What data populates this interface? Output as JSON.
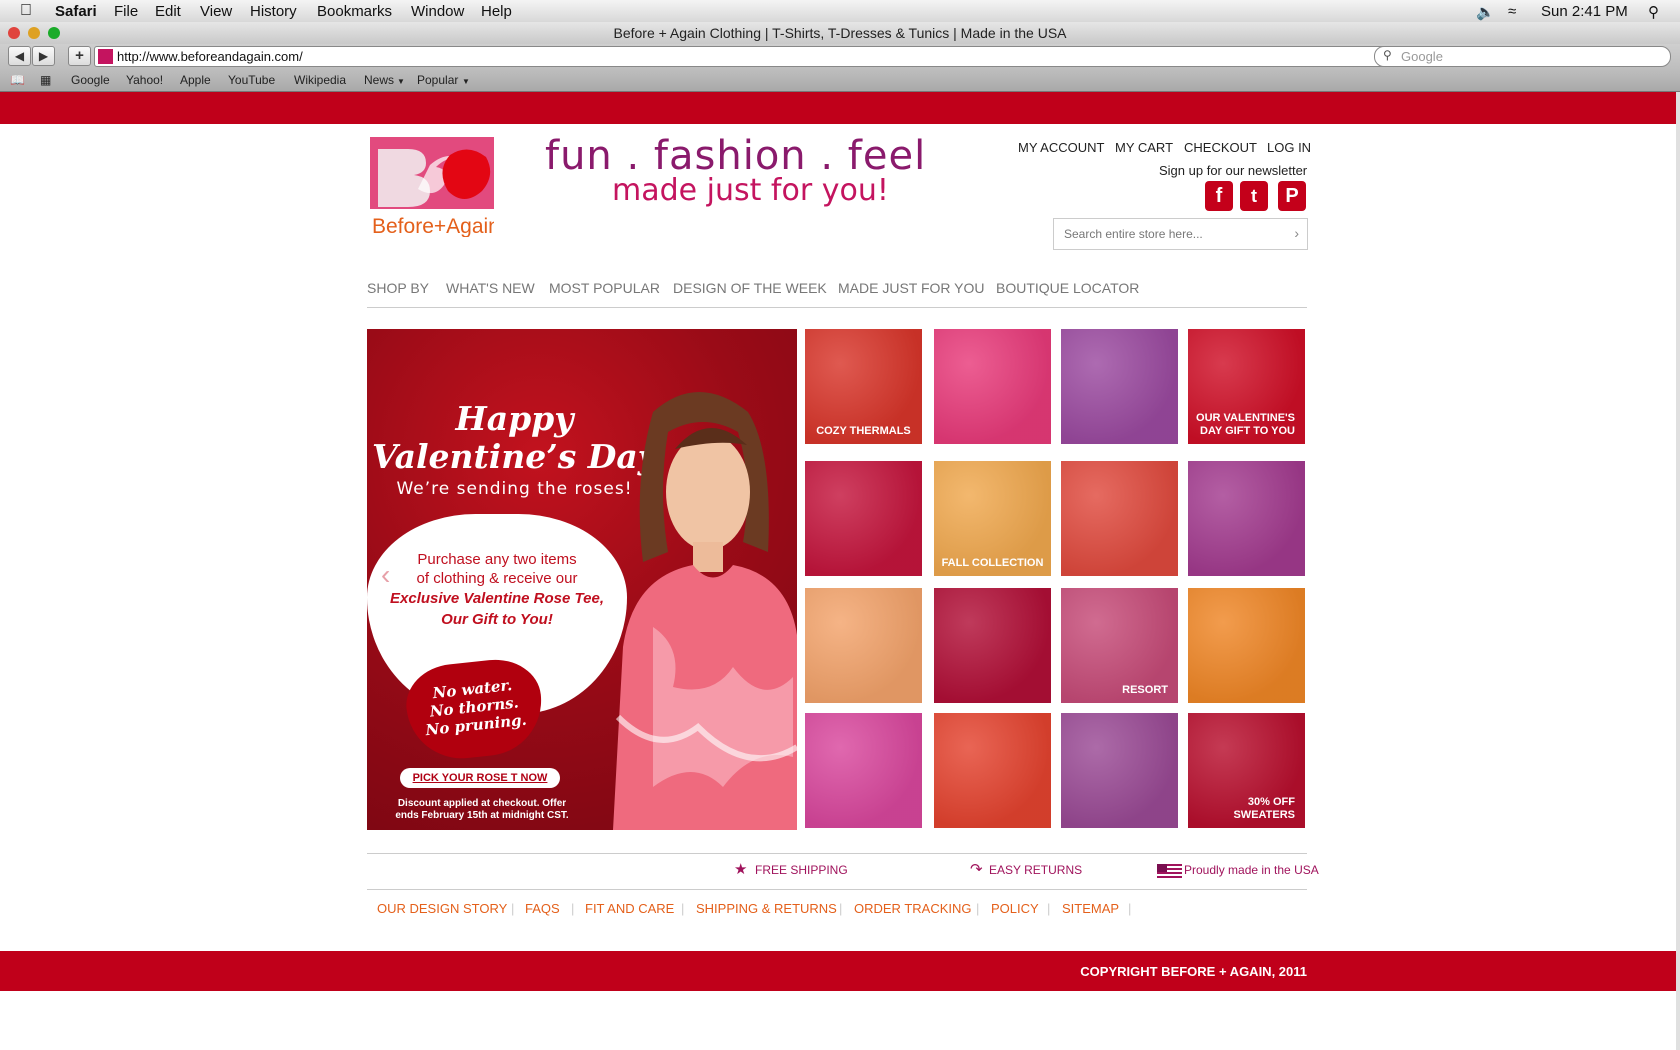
{
  "menubar": {
    "app": "Safari",
    "items": [
      "File",
      "Edit",
      "View",
      "History",
      "Bookmarks",
      "Window",
      "Help"
    ],
    "clock": "Sun 2:41 PM"
  },
  "browser": {
    "title": "Before + Again Clothing | T-Shirts, T-Dresses & Tunics | Made in the USA",
    "url": "http://www.beforeandagain.com/",
    "search_placeholder": "Google",
    "bookmarks": [
      "Google",
      "Yahoo!",
      "Apple",
      "YouTube",
      "Wikipedia",
      "News",
      "Popular"
    ]
  },
  "site": {
    "logo_text": "Before+Again",
    "tagline_line1": "fun . fashion . feel",
    "tagline_line2": "made just for you!",
    "account_links": [
      "MY ACCOUNT",
      "MY CART",
      "CHECKOUT",
      "LOG IN"
    ],
    "newsletter": "Sign up for our newsletter",
    "search_placeholder": "Search entire store here...",
    "nav": [
      "SHOP BY",
      "WHAT'S NEW",
      "MOST POPULAR",
      "DESIGN OF THE WEEK",
      "MADE JUST FOR YOU",
      "BOUTIQUE LOCATOR"
    ]
  },
  "hero": {
    "title1": "Happy",
    "title2": "Valentine’s Day",
    "subtitle": "We’re sending the roses!",
    "offer1": "Purchase any two items",
    "offer2": "of clothing & receive our",
    "offer3": "Exclusive Valentine Rose Tee,",
    "offer4": "Our Gift to You!",
    "heart1": "No water.",
    "heart2": "No thorns.",
    "heart3": "No pruning.",
    "cta": "PICK YOUR ROSE T NOW",
    "fine1": "Discount applied at checkout. Offer",
    "fine2": "ends February 15th at midnight CST."
  },
  "tiles": [
    {
      "label": "COZY THERMALS",
      "color": "#d8352a"
    },
    {
      "label": "",
      "color": "#e83a7a"
    },
    {
      "label": "",
      "color": "#9b4aa0"
    },
    {
      "label": "OUR VALENTINE'S DAY GIFT TO YOU",
      "color": "#cf0f27"
    },
    {
      "label": "",
      "color": "#c4153d"
    },
    {
      "label": "FALL COLLECTION",
      "color": "#f0a84e"
    },
    {
      "label": "",
      "color": "#e04a3e"
    },
    {
      "label": "",
      "color": "#a33b8f"
    },
    {
      "label": "",
      "color": "#f3a36b"
    },
    {
      "label": "",
      "color": "#b10f37"
    },
    {
      "label": "RESORT",
      "color": "#c64b78"
    },
    {
      "label": "",
      "color": "#ef8626"
    },
    {
      "label": "",
      "color": "#d9479d"
    },
    {
      "label": "",
      "color": "#e4432f"
    },
    {
      "label": "",
      "color": "#9a4a95"
    },
    {
      "label": "30% OFF SWEATERS",
      "color": "#b80f2e"
    }
  ],
  "features": [
    "FREE SHIPPING",
    "EASY RETURNS",
    "Proudly made in the USA"
  ],
  "footer_links": [
    "OUR DESIGN STORY",
    "FAQS",
    "FIT AND CARE",
    "SHIPPING & RETURNS",
    "ORDER TRACKING",
    "POLICY",
    "SITEMAP"
  ],
  "copyright": "COPYRIGHT BEFORE + AGAIN, 2011",
  "colors": {
    "brand_red": "#c0001a",
    "accent_orange": "#e4601b",
    "accent_magenta": "#a0135c"
  }
}
